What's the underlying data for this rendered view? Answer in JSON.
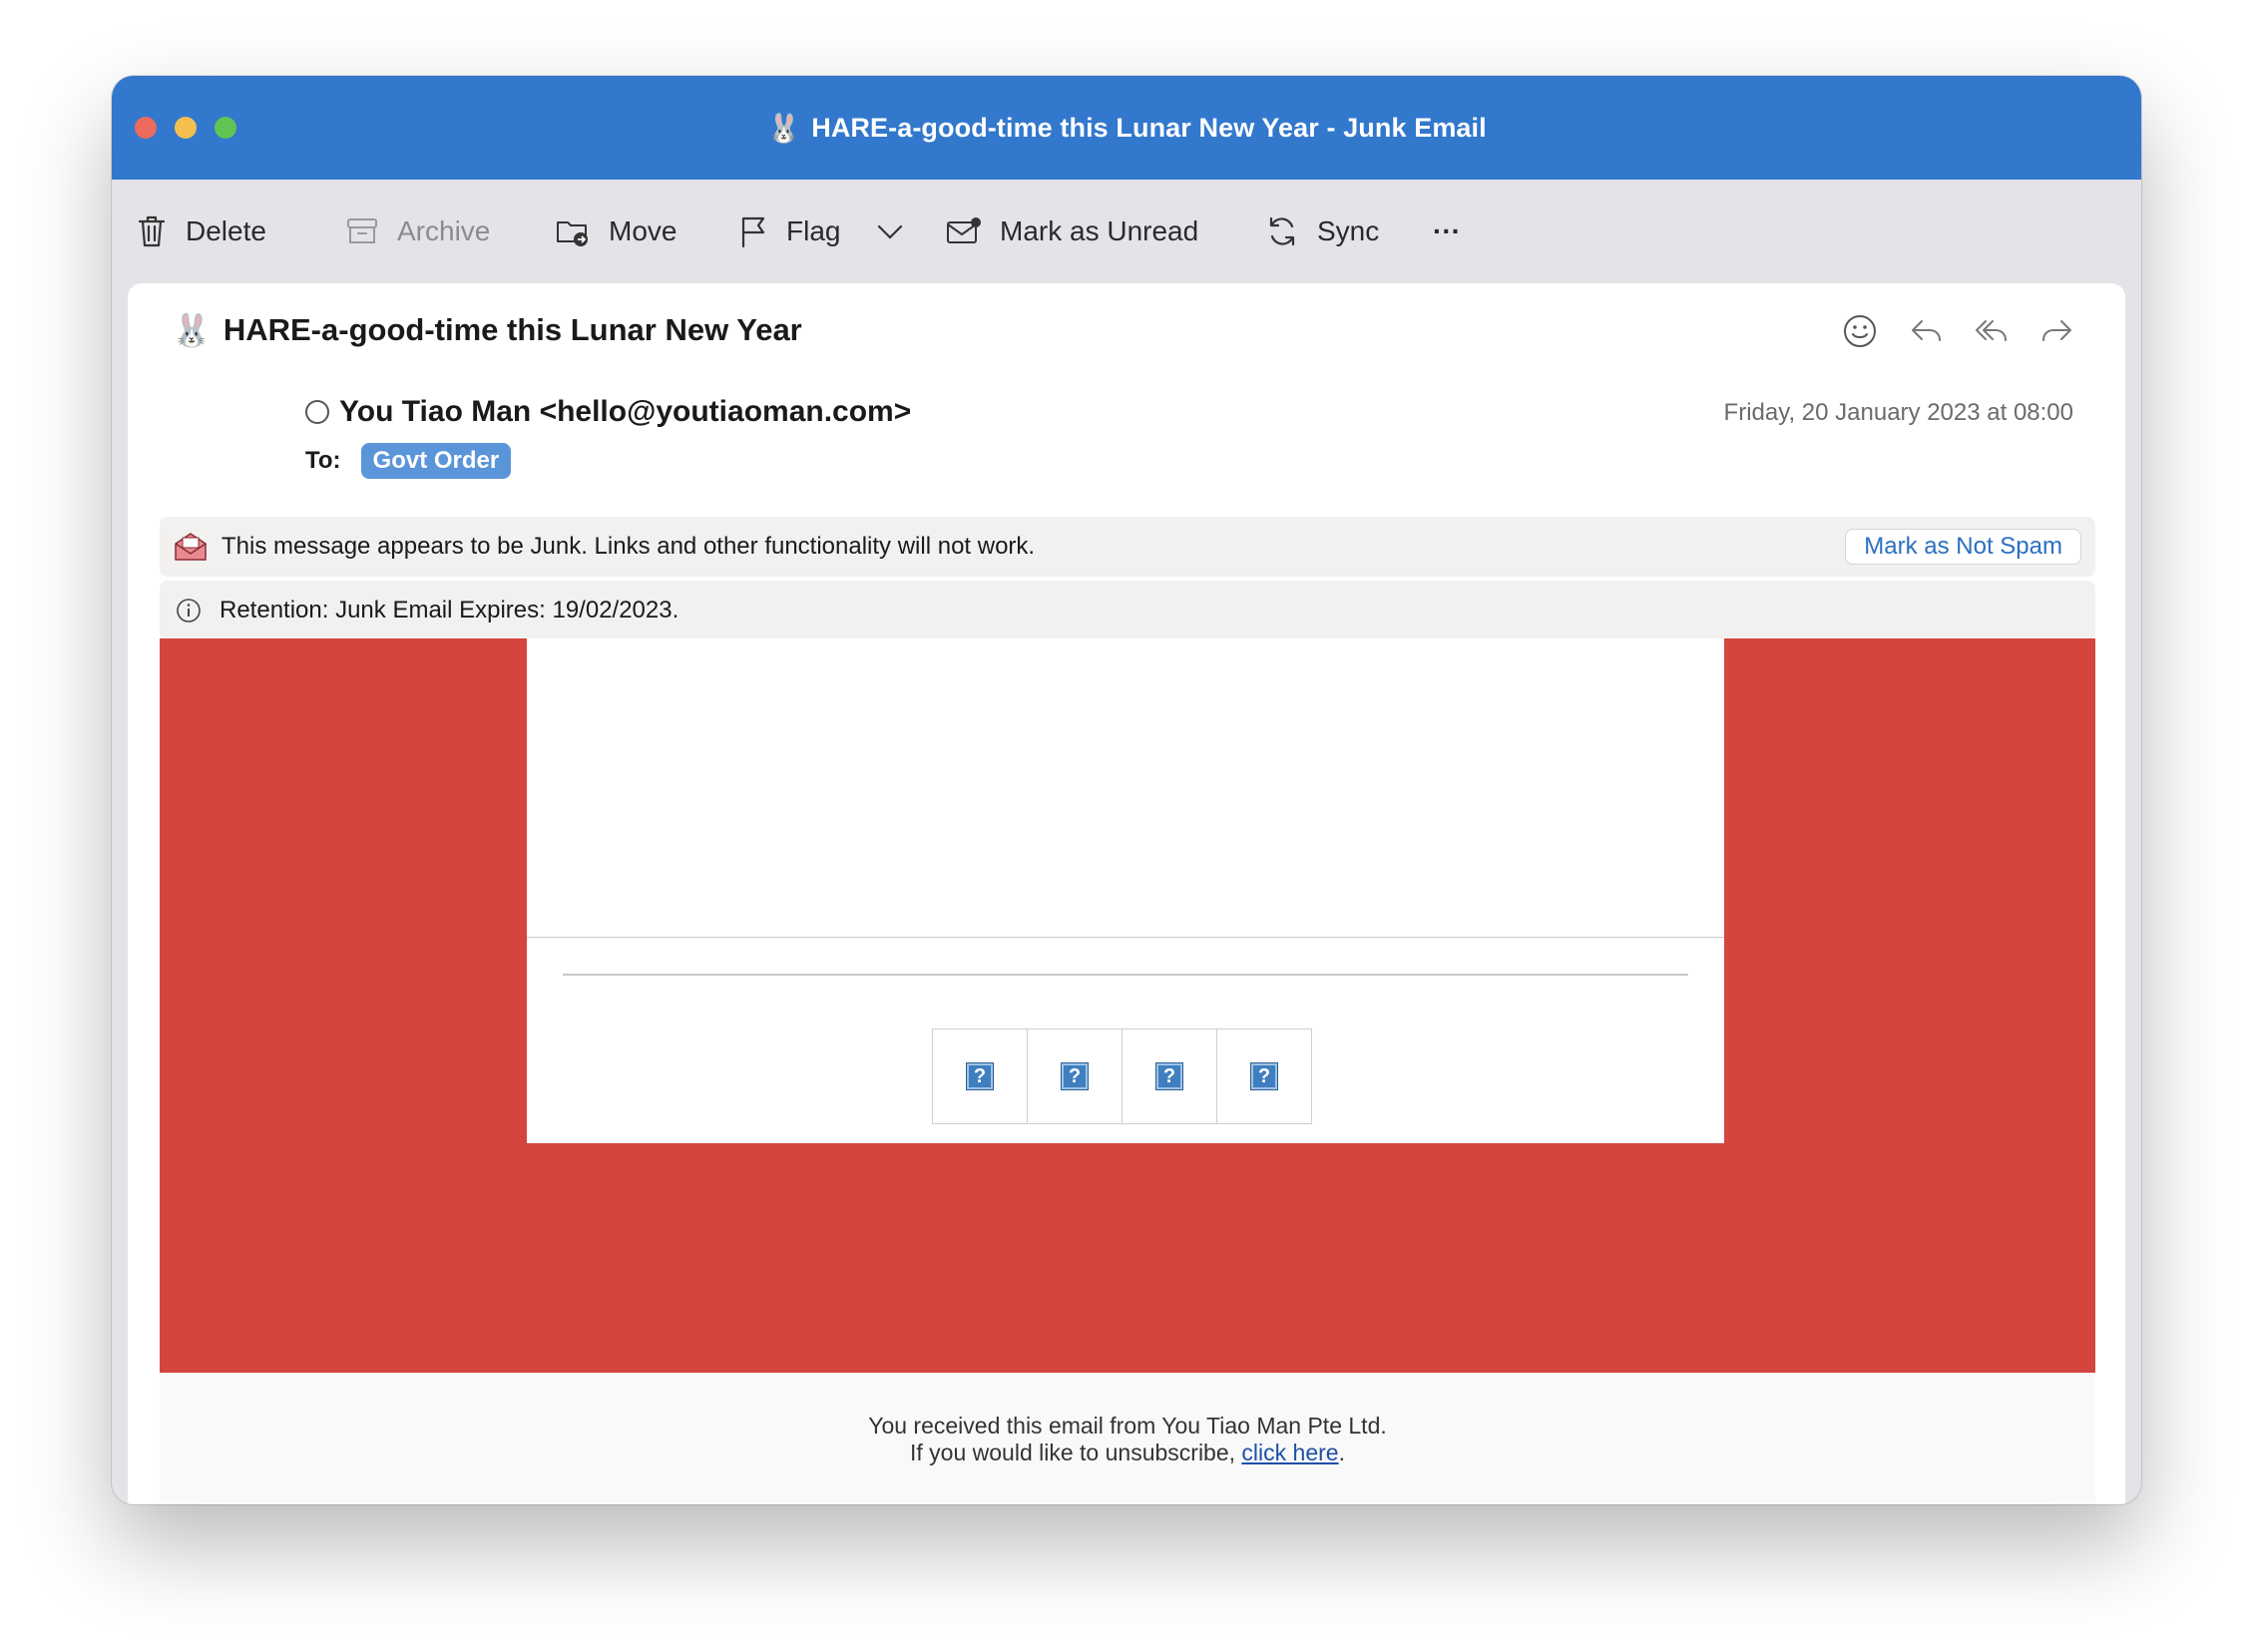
{
  "window": {
    "title_emoji": "🐰",
    "title": "HARE-a-good-time this Lunar New Year - Junk Email"
  },
  "toolbar": {
    "delete_label": "Delete",
    "archive_label": "Archive",
    "move_label": "Move",
    "flag_label": "Flag",
    "mark_unread_label": "Mark as Unread",
    "sync_label": "Sync",
    "more_label": "···"
  },
  "message": {
    "subject_emoji": "🐰",
    "subject": "HARE-a-good-time this Lunar New Year",
    "from": "You Tiao Man <hello@youtiaoman.com>",
    "date": "Friday, 20 January 2023 at 08:00",
    "to_label": "To:",
    "to_recipient": "Govt Order"
  },
  "junk_notice": {
    "text": "This message appears to be Junk. Links and other functionality will not work.",
    "button_label": "Mark as Not Spam"
  },
  "retention": {
    "text": "Retention: Junk Email Expires: 19/02/2023."
  },
  "body": {
    "background_color": "#d4453e",
    "broken_image_glyph": "?"
  },
  "footer": {
    "line1": "You received this email from You Tiao Man Pte Ltd.",
    "line2_prefix": "If you would like to unsubscribe, ",
    "link_text": "click here",
    "line2_suffix": "."
  },
  "colors": {
    "titlebar": "#3278cd",
    "accent_link": "#2b6fc0",
    "chip": "#5b95d9"
  }
}
